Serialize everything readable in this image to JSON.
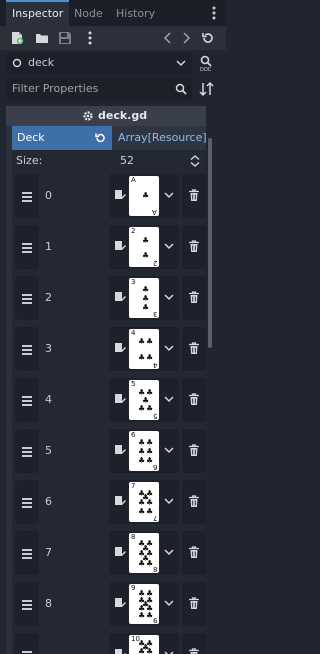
{
  "tabs": [
    {
      "label": "Inspector",
      "active": true
    },
    {
      "label": "Node",
      "active": false
    },
    {
      "label": "History",
      "active": false
    }
  ],
  "toolbar": {
    "icons": [
      "new-resource-icon",
      "open-folder-icon",
      "save-icon",
      "more-icon",
      "back-arrow-icon",
      "forward-arrow-icon",
      "history-icon"
    ]
  },
  "object_selector": {
    "value": "deck"
  },
  "filter": {
    "placeholder": "Filter Properties"
  },
  "script": {
    "title": "deck.gd"
  },
  "property": {
    "name": "Deck",
    "value": "Array[Resource] (si"
  },
  "array": {
    "size_label": "Size:",
    "size_value": "52",
    "elements": [
      {
        "index": "0",
        "card": "A"
      },
      {
        "index": "1",
        "card": "2"
      },
      {
        "index": "2",
        "card": "3"
      },
      {
        "index": "3",
        "card": "4"
      },
      {
        "index": "4",
        "card": "5"
      },
      {
        "index": "5",
        "card": "6"
      },
      {
        "index": "6",
        "card": "7"
      },
      {
        "index": "7",
        "card": "8"
      },
      {
        "index": "8",
        "card": "9"
      },
      {
        "index": "",
        "card": "10"
      }
    ]
  },
  "colors": {
    "accent": "#3e6fa8",
    "background": "#202531",
    "panel": "#2b303b"
  }
}
